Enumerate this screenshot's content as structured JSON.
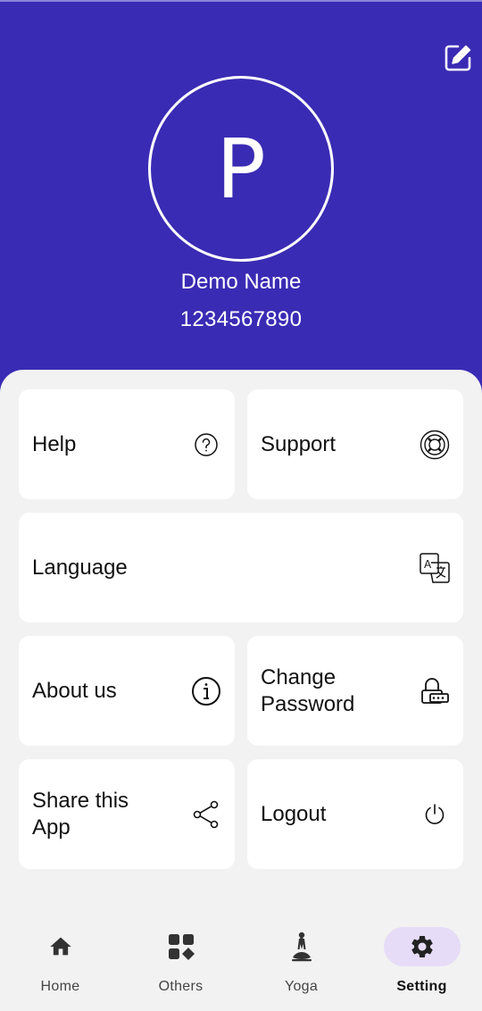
{
  "header": {
    "avatar_letter": "P",
    "name": "Demo Name",
    "phone": "1234567890",
    "background_color": "#3a2bb4",
    "edit_icon": "edit-icon"
  },
  "menu": {
    "help": {
      "label": "Help",
      "icon": "help-circle-icon"
    },
    "support": {
      "label": "Support",
      "icon": "lifebuoy-icon"
    },
    "language": {
      "label": "Language",
      "icon": "translate-icon"
    },
    "about": {
      "label": "About us",
      "icon": "info-icon"
    },
    "change_password": {
      "label": "Change\nPassword",
      "icon": "lock-password-icon"
    },
    "share": {
      "label": "Share this\nApp",
      "icon": "share-icon"
    },
    "logout": {
      "label": "Logout",
      "icon": "power-icon"
    }
  },
  "bottom_nav": {
    "items": [
      {
        "label": "Home",
        "icon": "home-icon"
      },
      {
        "label": "Others",
        "icon": "grid-icon"
      },
      {
        "label": "Yoga",
        "icon": "yoga-icon"
      },
      {
        "label": "Setting",
        "icon": "gear-icon",
        "active": true
      }
    ],
    "active_color": "#e7dcf7"
  }
}
